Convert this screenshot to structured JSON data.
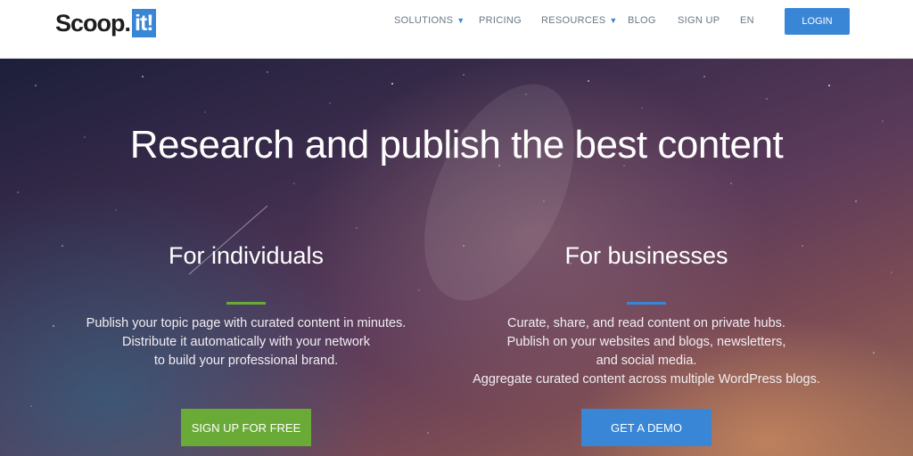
{
  "header": {
    "logo": {
      "text": "Scoop.",
      "badge": "it!"
    },
    "nav": [
      {
        "label": "SOLUTIONS",
        "has_dropdown": true
      },
      {
        "label": "PRICING",
        "has_dropdown": false
      },
      {
        "label": "RESOURCES",
        "has_dropdown": true
      },
      {
        "label": "BLOG",
        "has_dropdown": false
      },
      {
        "label": "SIGN UP",
        "has_dropdown": false
      },
      {
        "label": "EN",
        "has_dropdown": false
      }
    ],
    "caret": "▼",
    "login_label": "LOGIN"
  },
  "hero": {
    "title": "Research and publish the best content",
    "individuals": {
      "title": "For individuals",
      "lines": [
        "Publish your topic page with curated content in minutes.",
        "Distribute it automatically with your network",
        "to build your professional brand."
      ],
      "cta": "SIGN UP FOR FREE"
    },
    "businesses": {
      "title": "For businesses",
      "lines": [
        "Curate, share, and read content on private hubs.",
        "Publish on your websites and blogs, newsletters,",
        "and social media.",
        "Aggregate curated content across multiple WordPress blogs."
      ],
      "cta": "GET A DEMO"
    }
  },
  "colors": {
    "brand_blue": "#3a86d6",
    "green": "#6aaa37",
    "nav_text": "#6b7785"
  }
}
